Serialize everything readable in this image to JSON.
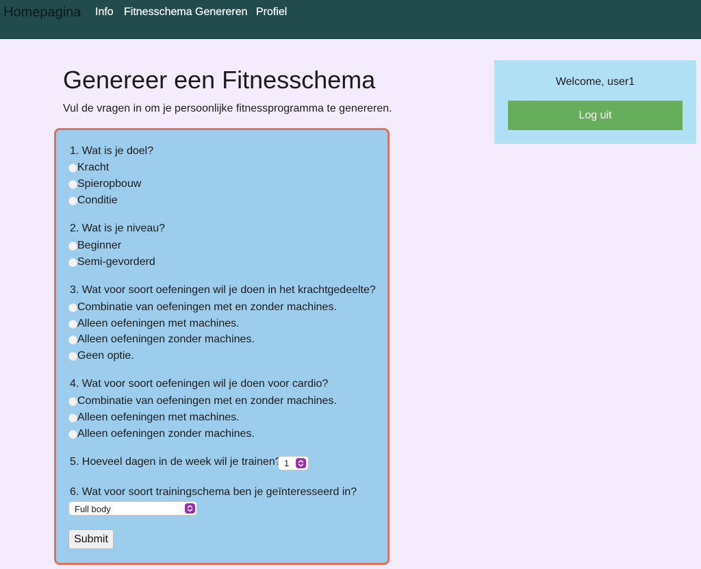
{
  "nav": {
    "brand": "Homepagina",
    "links": [
      "Info",
      "Fitnesschema Genereren",
      "Profiel"
    ]
  },
  "main": {
    "title": "Genereer een Fitnesschema",
    "intro": "Vul de vragen in om je persoonlijke fitnessprogramma te genereren."
  },
  "form": {
    "q1": {
      "label": "1. Wat is je doel?",
      "options": [
        "Kracht",
        "Spieropbouw",
        "Conditie"
      ]
    },
    "q2": {
      "label": "2. Wat is je niveau?",
      "options": [
        "Beginner",
        "Semi-gevorderd"
      ]
    },
    "q3": {
      "label": "3. Wat voor soort oefeningen wil je doen in het krachtgedeelte?",
      "options": [
        "Combinatie van oefeningen met en zonder machines.",
        "Alleen oefeningen met machines.",
        "Alleen oefeningen zonder machines.",
        "Geen optie."
      ]
    },
    "q4": {
      "label": "4. Wat voor soort oefeningen wil je doen voor cardio?",
      "options": [
        "Combinatie van oefeningen met en zonder machines.",
        "Alleen oefeningen met machines.",
        "Alleen oefeningen zonder machines."
      ]
    },
    "q5": {
      "label": "5. Hoeveel dagen in de week wil je trainen?",
      "selected": "1"
    },
    "q6": {
      "label": "6. Wat voor soort trainingschema ben je geïnteresseerd in?",
      "selected": "Full body"
    },
    "submit_label": "Submit"
  },
  "sidebar": {
    "welcome": "Welcome, user1",
    "logout_label": "Log uit"
  },
  "colors": {
    "navbar": "#224b4d",
    "page_bg": "#f4ecfc",
    "form_bg": "#9ccdec",
    "form_border": "#e0715a",
    "side_bg": "#b1e0f5",
    "logout_bg": "#66ae5c",
    "select_accent": "#9a2fb0"
  }
}
